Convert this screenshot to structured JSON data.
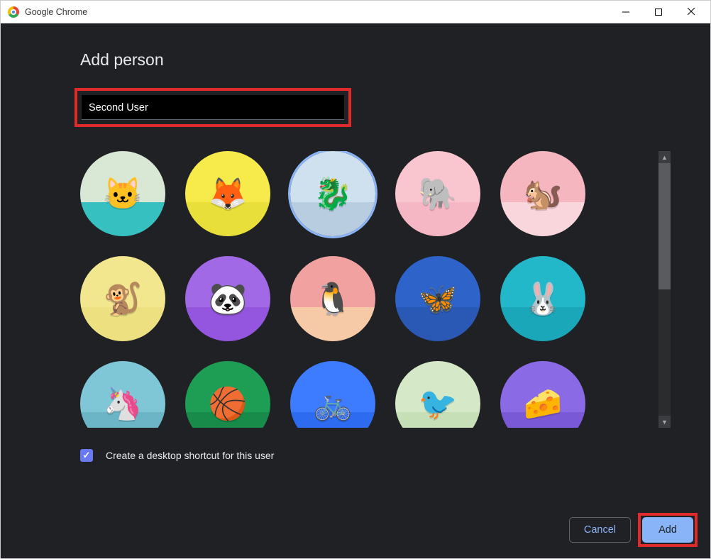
{
  "window": {
    "title": "Google Chrome"
  },
  "heading": "Add person",
  "name_input": {
    "value": "Second User"
  },
  "avatars": [
    {
      "id": "origami-cat",
      "bg_top": "#d9e8d5",
      "bg_bot": "#37c0c0",
      "emoji": "🐱",
      "selected": false
    },
    {
      "id": "origami-fox",
      "bg_top": "#f6eb4a",
      "bg_bot": "#e9df3a",
      "emoji": "🦊",
      "selected": false
    },
    {
      "id": "origami-dragon",
      "bg_top": "#cfe0ee",
      "bg_bot": "#b8cde0",
      "emoji": "🐉",
      "selected": true
    },
    {
      "id": "origami-elephant",
      "bg_top": "#f9c5cf",
      "bg_bot": "#f6b7c4",
      "emoji": "🐘",
      "selected": false
    },
    {
      "id": "origami-squirrel",
      "bg_top": "#f5b6c0",
      "bg_bot": "#f9d6db",
      "emoji": "🐿️",
      "selected": false
    },
    {
      "id": "origami-monkey",
      "bg_top": "#f2e68f",
      "bg_bot": "#ece080",
      "emoji": "🐒",
      "selected": false
    },
    {
      "id": "origami-panda",
      "bg_top": "#a169e6",
      "bg_bot": "#9556df",
      "emoji": "🐼",
      "selected": false
    },
    {
      "id": "origami-penguin",
      "bg_top": "#f2a1a1",
      "bg_bot": "#f6caa6",
      "emoji": "🐧",
      "selected": false
    },
    {
      "id": "origami-butterfly",
      "bg_top": "#2e63c9",
      "bg_bot": "#2a58b5",
      "emoji": "🦋",
      "selected": false
    },
    {
      "id": "origami-rabbit",
      "bg_top": "#22b7c9",
      "bg_bot": "#1aa7b9",
      "emoji": "🐰",
      "selected": false
    },
    {
      "id": "origami-unicorn",
      "bg_top": "#7fc6d6",
      "bg_bot": "#6bb5c7",
      "emoji": "🦄",
      "selected": false
    },
    {
      "id": "basketball",
      "bg_top": "#1e9e55",
      "bg_bot": "#188a49",
      "emoji": "🏀",
      "selected": false
    },
    {
      "id": "bicycle",
      "bg_top": "#3d7cff",
      "bg_bot": "#2d6bf0",
      "emoji": "🚲",
      "selected": false
    },
    {
      "id": "bird",
      "bg_top": "#d5e9c8",
      "bg_bot": "#c6dfb7",
      "emoji": "🐦",
      "selected": false
    },
    {
      "id": "cheese",
      "bg_top": "#8a6be5",
      "bg_bot": "#7a59d7",
      "emoji": "🧀",
      "selected": false
    }
  ],
  "checkbox": {
    "checked": true,
    "label": "Create a desktop shortcut for this user"
  },
  "buttons": {
    "cancel": "Cancel",
    "add": "Add"
  },
  "highlight": {
    "name_input": true,
    "add_button": true
  }
}
